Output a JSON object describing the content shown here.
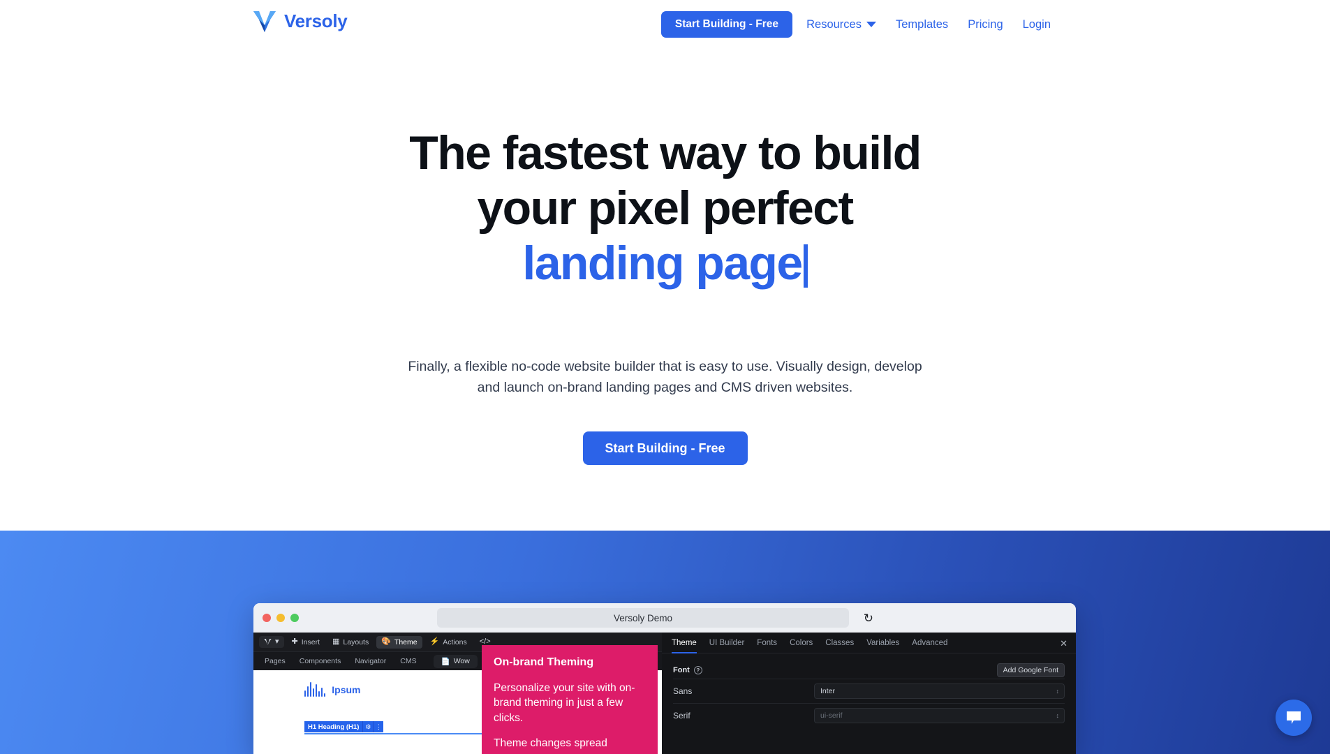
{
  "header": {
    "brand_name": "Versoly",
    "logo_icon": "versoly-v-logo",
    "nav": [
      {
        "label": "Resources",
        "has_dropdown": true,
        "icon": "chevron-down-icon"
      },
      {
        "label": "Templates",
        "has_dropdown": false
      },
      {
        "label": "Pricing",
        "has_dropdown": false
      },
      {
        "label": "Login",
        "has_dropdown": false
      }
    ],
    "cta_label": "Start Building - Free"
  },
  "hero": {
    "title_line1": "The fastest way to build",
    "title_line2": "your pixel perfect",
    "title_accent": "landing page",
    "subtitle": "Finally, a flexible no-code website builder that is easy to use. Visually design, develop and launch on-brand landing pages and CMS driven websites.",
    "cta_label": "Start Building - Free"
  },
  "colors": {
    "brand_blue": "#2c63e8",
    "accent_pink": "#dd1c69",
    "band_gradient_from": "#4c8af2",
    "band_gradient_to": "#1e3a95",
    "text_dark": "#0d1117",
    "text_muted": "#323b4d"
  },
  "browser": {
    "window_title": "Versoly Demo",
    "reload_icon": "reload-icon",
    "traffic_lights": [
      "close-dot-red",
      "minimize-dot-yellow",
      "maximize-dot-green"
    ]
  },
  "app": {
    "toolbar": [
      {
        "label": "Insert",
        "icon": "plus-icon"
      },
      {
        "label": "Layouts",
        "icon": "grid-icon"
      },
      {
        "label": "Theme",
        "icon": "palette-icon",
        "active": true
      },
      {
        "label": "Actions",
        "icon": "lightning-icon"
      },
      {
        "label": "",
        "icon": "code-icon"
      }
    ],
    "subtabs": [
      "Pages",
      "Components",
      "Navigator",
      "CMS"
    ],
    "page_chip": {
      "label": "Wow",
      "icon": "page-icon"
    },
    "canvas": {
      "logo_text": "Ipsum",
      "logo_icon": "soundbars-icon",
      "element_badge": "H1 Heading (H1)",
      "badge_settings_icon": "gear-icon",
      "badge_more_icon": "kebab-menu-icon"
    }
  },
  "callout": {
    "title": "On-brand Theming",
    "paragraph1": "Personalize your site with on-brand theming in just a few clicks.",
    "paragraph2": "Theme changes spread"
  },
  "theme_panel": {
    "tabs": [
      "Theme",
      "UI Builder",
      "Fonts",
      "Colors",
      "Classes",
      "Variables",
      "Advanced"
    ],
    "active_tab": "Theme",
    "close_icon": "close-icon",
    "font_section": {
      "label": "Font",
      "help_icon": "question-mark-icon",
      "add_button": "Add Google Font",
      "rows": [
        {
          "key": "Sans",
          "value": "Inter",
          "muted": false
        },
        {
          "key": "Serif",
          "value": "ui-serif",
          "muted": true
        }
      ]
    }
  },
  "chat": {
    "icon": "chat-bubble-icon"
  }
}
